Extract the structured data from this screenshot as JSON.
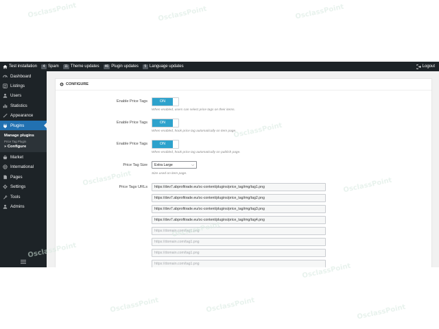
{
  "topbar": {
    "site": "Test installation",
    "items": [
      {
        "count": "4",
        "label": "Spam",
        "icon": "spam-badge"
      },
      {
        "count": "11",
        "label": "Theme updates",
        "icon": "theme-updates-badge"
      },
      {
        "count": "46",
        "label": "Plugin updates",
        "icon": "plugin-updates-badge"
      },
      {
        "count": "5",
        "label": "Language updates",
        "icon": "language-updates-badge"
      }
    ],
    "logout": "Logout"
  },
  "sidebar": {
    "items": [
      {
        "label": "Dashboard",
        "icon": "dashboard-icon",
        "active": false
      },
      {
        "label": "Listings",
        "icon": "listings-icon",
        "active": false
      },
      {
        "label": "Users",
        "icon": "users-icon",
        "active": false
      },
      {
        "label": "Statistics",
        "icon": "statistics-icon",
        "active": false
      },
      {
        "label": "Appearance",
        "icon": "appearance-icon",
        "active": false
      },
      {
        "label": "Plugins",
        "icon": "plugins-icon",
        "active": true
      }
    ],
    "submenu": {
      "manage": "Manage plugins",
      "plugin_name": "Price Tag Plugin",
      "configure": "» Configure"
    },
    "items_after": [
      {
        "label": "Market",
        "icon": "market-icon"
      },
      {
        "label": "International",
        "icon": "globe-icon"
      },
      {
        "label": "Pages",
        "icon": "pages-icon"
      },
      {
        "label": "Settings",
        "icon": "settings-icon"
      },
      {
        "label": "Tools",
        "icon": "tools-icon"
      },
      {
        "label": "Admins",
        "icon": "admins-icon"
      }
    ]
  },
  "panel": {
    "title": "Configure",
    "toggles": [
      {
        "label": "Enable Price Tags",
        "value": "ON",
        "help": "When enabled, users can select price tags on their items."
      },
      {
        "label": "Enable Price Tags",
        "value": "ON",
        "help": "When enabled, hook price tag automatically on item page."
      },
      {
        "label": "Enable Price Tags",
        "value": "ON",
        "help": "When enabled, hook price tag automatically on publish page."
      }
    ],
    "size": {
      "label": "Price Tag Size",
      "value": "Extra Large",
      "help": "Size used on item page."
    },
    "urls": {
      "label": "Price Tags URLs",
      "values": [
        "https://dev7.abprofitrade.eu/oc-content/plugins/price_tag/img/tag1.png",
        "https://dev7.abprofitrade.eu/oc-content/plugins/price_tag/img/tag2.png",
        "https://dev7.abprofitrade.eu/oc-content/plugins/price_tag/img/tag3.png",
        "https://dev7.abprofitrade.eu/oc-content/plugins/price_tag/img/tag4.png"
      ],
      "placeholders": [
        "https://domain.com/tag1.png",
        "https://domain.com/tag1.png",
        "https://domain.com/tag1.png",
        "https://domain.com/tag1.png"
      ]
    }
  },
  "watermark": "OsclassPoint",
  "colors": {
    "adminbar": "#1d2327",
    "accent": "#2271b1",
    "toggle_on": "#2ea2cc",
    "background": "#f1f1f1"
  }
}
